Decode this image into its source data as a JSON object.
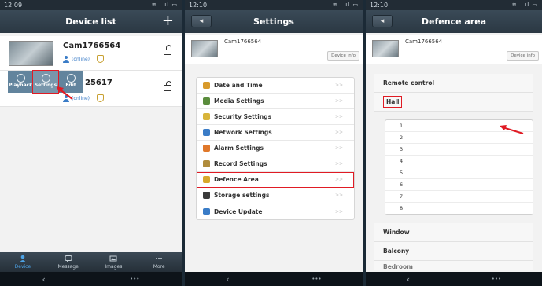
{
  "panel1": {
    "status_time": "12:09",
    "status_icons": "≋ ..ıl ▭",
    "title": "Device list",
    "add_icon": "plus-icon",
    "devices": [
      {
        "name": "Cam1766564",
        "status": "(online)"
      },
      {
        "name_partial": "25617",
        "status": "(online)"
      }
    ],
    "actions": [
      "Playback",
      "Settings",
      "Edit"
    ],
    "tabs": [
      "Device",
      "Message",
      "Images",
      "More"
    ],
    "nav_back": "‹",
    "nav_more": "•••"
  },
  "panel2": {
    "status_time": "12:10",
    "status_icons": "≋ ..ıl ▭",
    "title": "Settings",
    "back_label": "◂",
    "camera_name": "Cam1766564",
    "info_button": "Device info",
    "menu": [
      {
        "label": "Date and Time",
        "color": "#d89a2b"
      },
      {
        "label": "Media Settings",
        "color": "#5a8c3c"
      },
      {
        "label": "Security Settings",
        "color": "#d8b43a"
      },
      {
        "label": "Network Settings",
        "color": "#3a7cc7"
      },
      {
        "label": "Alarm Settings",
        "color": "#e0782a"
      },
      {
        "label": "Record Settings",
        "color": "#b08c3c"
      },
      {
        "label": "Defence Area",
        "color": "#d8a82a"
      },
      {
        "label": "Storage settings",
        "color": "#3a3a3a"
      },
      {
        "label": "Device Update",
        "color": "#3a7cc7"
      }
    ],
    "chevron": ">>",
    "nav_back": "‹",
    "nav_more": "•••"
  },
  "panel3": {
    "status_time": "12:10",
    "status_icons": "≋ ..ıl ▭",
    "title": "Defence area",
    "back_label": "◂",
    "camera_name": "Cam1766564",
    "info_button": "Device info",
    "remote_control": "Remote control",
    "hall": "Hall",
    "codes": [
      "1",
      "2",
      "3",
      "4",
      "5",
      "6",
      "7",
      "8"
    ],
    "window": "Window",
    "balcony": "Balcony",
    "bedroom": "Bedroom",
    "nav_back": "‹",
    "nav_more": "•••"
  }
}
